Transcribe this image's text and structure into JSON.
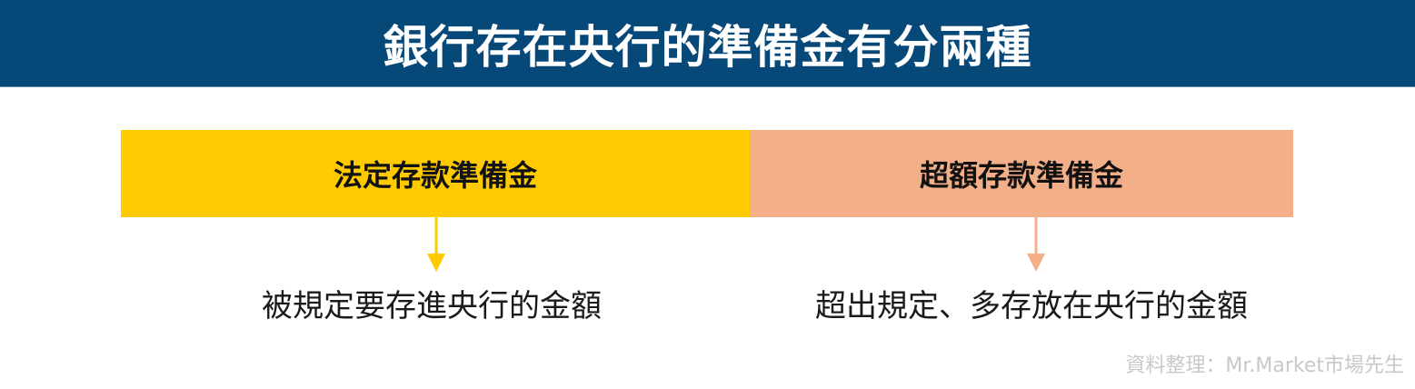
{
  "title": "銀行存在央行的準備金有分兩種",
  "left": {
    "label": "法定存款準備金",
    "description": "被規定要存進央行的金額",
    "color": "#ffcb00"
  },
  "right": {
    "label": "超額存款準備金",
    "description": "超出規定、多存放在央行的金額",
    "color": "#f3b088"
  },
  "header_color": "#064878",
  "source": "資料整理：Mr.Market市場先生"
}
